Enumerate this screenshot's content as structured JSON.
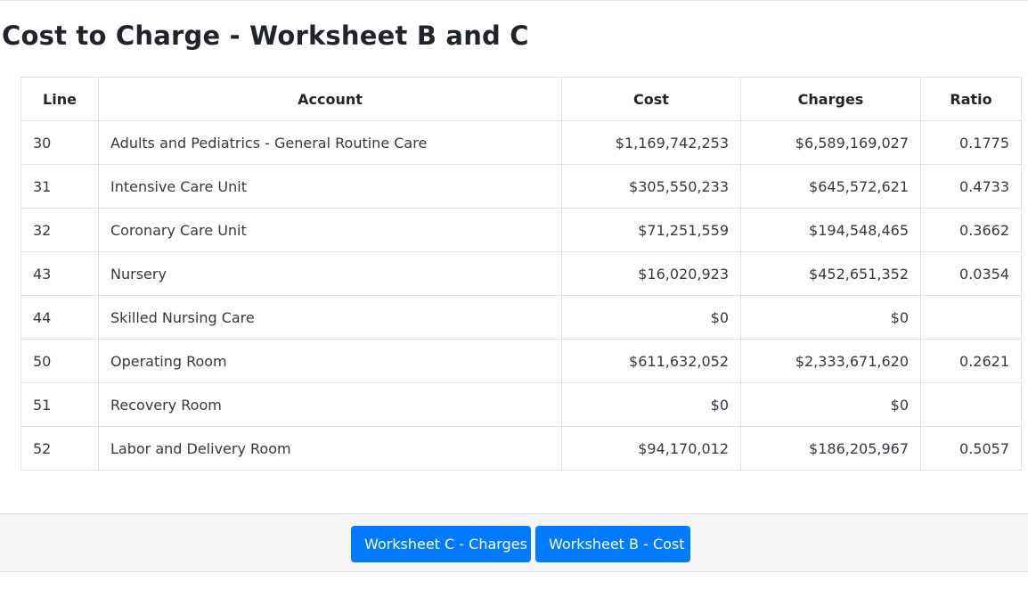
{
  "page": {
    "title": "Cost to Charge - Worksheet B and C"
  },
  "table": {
    "headers": {
      "line": "Line",
      "account": "Account",
      "cost": "Cost",
      "charges": "Charges",
      "ratio": "Ratio"
    },
    "rows": [
      {
        "line": "30",
        "account": "Adults and Pediatrics - General Routine Care",
        "cost": "$1,169,742,253",
        "charges": "$6,589,169,027",
        "ratio": "0.1775"
      },
      {
        "line": "31",
        "account": "Intensive Care Unit",
        "cost": "$305,550,233",
        "charges": "$645,572,621",
        "ratio": "0.4733"
      },
      {
        "line": "32",
        "account": "Coronary Care Unit",
        "cost": "$71,251,559",
        "charges": "$194,548,465",
        "ratio": "0.3662"
      },
      {
        "line": "43",
        "account": "Nursery",
        "cost": "$16,020,923",
        "charges": "$452,651,352",
        "ratio": "0.0354"
      },
      {
        "line": "44",
        "account": "Skilled Nursing Care",
        "cost": "$0",
        "charges": "$0",
        "ratio": ""
      },
      {
        "line": "50",
        "account": "Operating Room",
        "cost": "$611,632,052",
        "charges": "$2,333,671,620",
        "ratio": "0.2621"
      },
      {
        "line": "51",
        "account": "Recovery Room",
        "cost": "$0",
        "charges": "$0",
        "ratio": ""
      },
      {
        "line": "52",
        "account": "Labor and Delivery Room",
        "cost": "$94,170,012",
        "charges": "$186,205,967",
        "ratio": "0.5057"
      }
    ]
  },
  "footer": {
    "worksheet_c_label": "Worksheet C - Charges",
    "worksheet_b_label": "Worksheet B - Cost"
  },
  "colors": {
    "primary_button": "#007bff",
    "footer_background": "#f5f5f5",
    "table_border": "#dee2e6"
  }
}
